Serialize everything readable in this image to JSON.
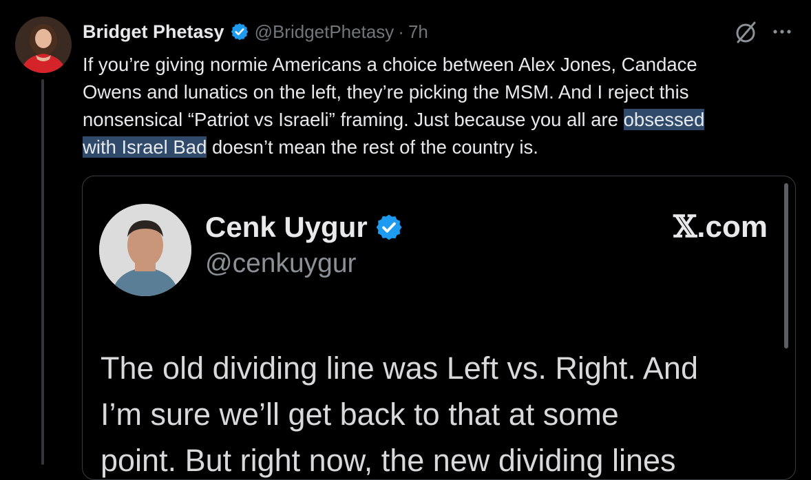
{
  "tweet": {
    "display_name": "Bridget Phetasy",
    "handle": "@BridgetPhetasy",
    "separator": "·",
    "time": "7h",
    "text_lines": [
      {
        "before": "If you’re giving normie Americans a choice between Alex Jones, Candace",
        "highlight": "",
        "after": ""
      },
      {
        "before": "Owens and lunatics on the left, they’re picking the MSM. And I reject this",
        "highlight": "",
        "after": ""
      },
      {
        "before": "nonsensical “Patriot vs Israeli” framing. Just because you all are ",
        "highlight": "obsessed",
        "after": ""
      },
      {
        "before": "",
        "highlight": "with Israel Bad",
        "after": " doesn’t mean the rest of the country is."
      }
    ]
  },
  "quote": {
    "display_name": "Cenk Uygur",
    "handle": "@cenkuygur",
    "site_x": "𝕏",
    "site_rest": ".com",
    "body_lines": [
      "The old dividing line was Left vs. Right. And",
      "I’m sure we’ll get back to that at some",
      "point. But right now, the new dividing lines"
    ]
  },
  "colors": {
    "background": "#000000",
    "text_primary": "#e7e9ea",
    "text_secondary": "#71767b",
    "verified_blue": "#1d9bf0",
    "highlight": "#2f4a6a"
  },
  "icons": [
    "verified-badge-icon",
    "grok-icon",
    "more-icon"
  ]
}
